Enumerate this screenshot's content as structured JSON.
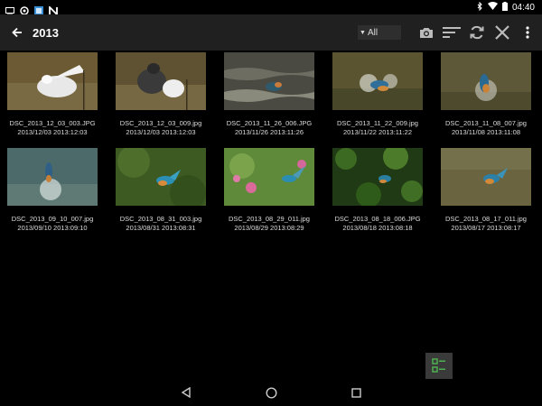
{
  "status_bar": {
    "time": "04:40"
  },
  "toolbar": {
    "title": "2013",
    "filter_value": "All"
  },
  "colors": {
    "toolbar_bg": "#202020",
    "background": "#000000",
    "fab_accent": "#4caf50"
  },
  "photos": [
    {
      "name": "DSC_2013_12_03_003.JPG",
      "date": "2013/12/03 2013:12:03"
    },
    {
      "name": "DSC_2013_12_03_009.jpg",
      "date": "2013/12/03 2013:12:03"
    },
    {
      "name": "DSC_2013_11_26_006.JPG",
      "date": "2013/11/26 2013:11:26"
    },
    {
      "name": "DSC_2013_11_22_009.jpg",
      "date": "2013/11/22 2013:11:22"
    },
    {
      "name": "DSC_2013_11_08_007.jpg",
      "date": "2013/11/08 2013:11:08"
    },
    {
      "name": "DSC_2013_09_10_007.jpg",
      "date": "2013/09/10 2013:09:10"
    },
    {
      "name": "DSC_2013_08_31_003.jpg",
      "date": "2013/08/31 2013:08:31"
    },
    {
      "name": "DSC_2013_08_29_011.jpg",
      "date": "2013/08/29 2013:08:29"
    },
    {
      "name": "DSC_2013_08_18_006.JPG",
      "date": "2013/08/18 2013:08:18"
    },
    {
      "name": "DSC_2013_08_17_011.jpg",
      "date": "2013/08/17 2013:08:17"
    }
  ]
}
